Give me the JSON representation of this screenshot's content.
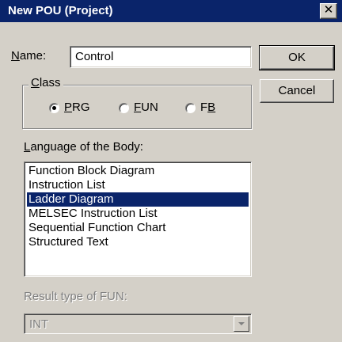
{
  "window": {
    "title": "New POU (Project)",
    "close_glyph": "✕"
  },
  "name_field": {
    "label_mnemonic": "N",
    "label_rest": "ame:",
    "value": "Control"
  },
  "buttons": {
    "ok": "OK",
    "cancel": "Cancel"
  },
  "class_group": {
    "legend_mnemonic": "C",
    "legend_rest": "lass",
    "options": [
      {
        "pre": "",
        "mnemonic": "P",
        "post": "RG",
        "checked": true
      },
      {
        "pre": "",
        "mnemonic": "F",
        "post": "UN",
        "checked": false
      },
      {
        "pre": "F",
        "mnemonic": "B",
        "post": "",
        "checked": false
      }
    ]
  },
  "language": {
    "label_mnemonic": "L",
    "label_rest": "anguage of the Body:",
    "items": [
      "Function Block Diagram",
      "Instruction List",
      "Ladder Diagram",
      "MELSEC Instruction List",
      "Sequential Function Chart",
      "Structured Text"
    ],
    "selected_index": 2
  },
  "result_type": {
    "label": "Result type of FUN:",
    "value": "INT",
    "enabled": false
  },
  "colors": {
    "titlebar": "#0a246a",
    "face": "#d4d0c8",
    "selection": "#0a246a"
  }
}
